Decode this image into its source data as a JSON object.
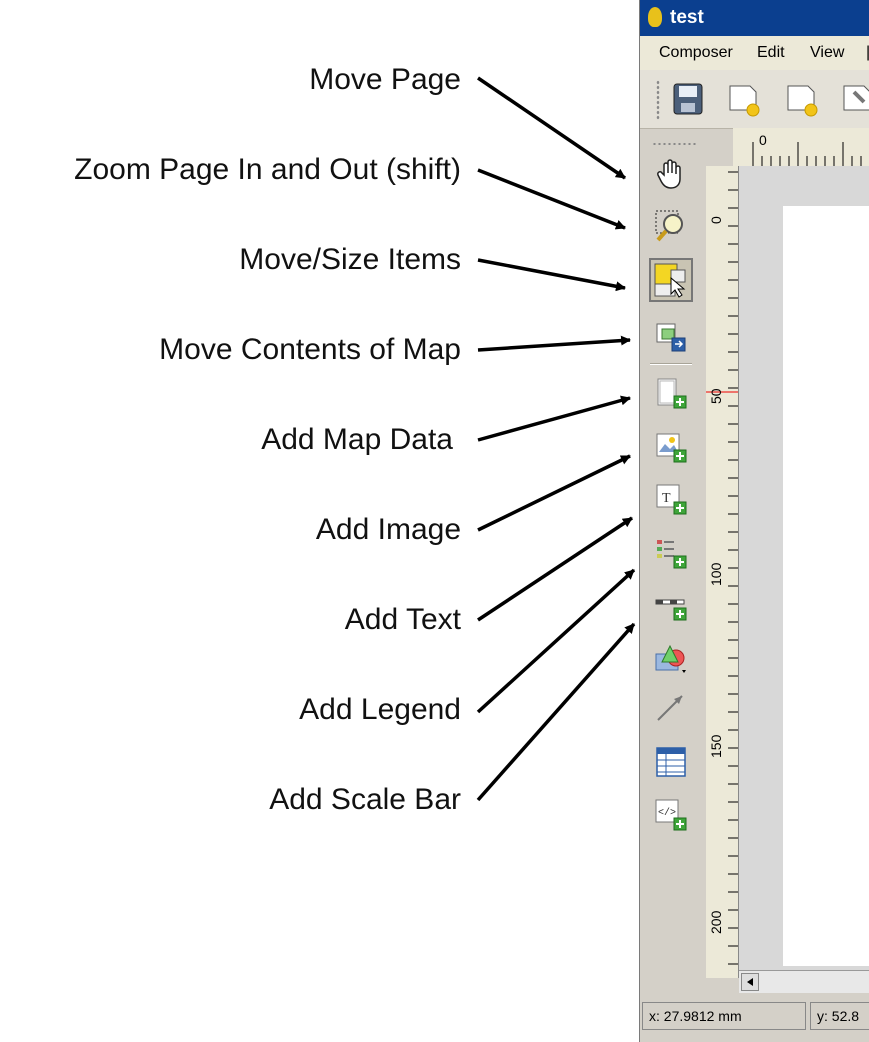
{
  "annotations": [
    "Move Page",
    "Zoom Page In and Out (shift)",
    "Move/Size Items",
    "Move Contents of Map",
    "Add Map Data",
    "Add Image",
    "Add Text",
    "Add Legend",
    "Add Scale Bar"
  ],
  "window": {
    "title": "test"
  },
  "menu": {
    "items": [
      "Composer",
      "Edit",
      "View"
    ]
  },
  "toolbar": {
    "buttons": [
      "save-icon",
      "new-composer-icon",
      "duplicate-composer-icon",
      "composer-manager-icon"
    ]
  },
  "toolbox": {
    "tools": [
      {
        "icon": "pan-hand-icon",
        "active": false
      },
      {
        "icon": "zoom-magnifier-icon",
        "active": false
      },
      {
        "icon": "select-move-item-icon",
        "active": true
      },
      {
        "icon": "move-item-content-icon",
        "active": false
      },
      {
        "icon": "add-map-icon",
        "active": false
      },
      {
        "icon": "add-image-icon",
        "active": false
      },
      {
        "icon": "add-label-icon",
        "active": false
      },
      {
        "icon": "add-legend-icon",
        "active": false
      },
      {
        "icon": "add-scalebar-icon",
        "active": false
      },
      {
        "icon": "add-shape-icon",
        "active": false
      },
      {
        "icon": "add-arrow-icon",
        "active": false
      },
      {
        "icon": "add-attribute-table-icon",
        "active": false
      },
      {
        "icon": "add-html-icon",
        "active": false
      }
    ]
  },
  "rulers": {
    "horizontal_label": "0",
    "vertical_labels": [
      "0",
      "50",
      "100",
      "150",
      "200"
    ]
  },
  "status": {
    "x": "x: 27.9812 mm",
    "y": "y: 52.8"
  },
  "colors": {
    "titlebar": "#0b3f8f",
    "active_tool": "#c9c4b3",
    "canvas": "#d8d8d8"
  }
}
